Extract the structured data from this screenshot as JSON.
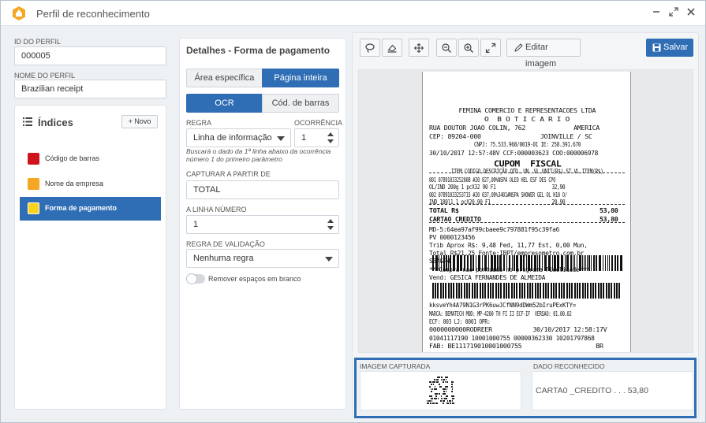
{
  "window": {
    "title": "Perfil de reconhecimento"
  },
  "profile": {
    "id_label": "ID DO PERFIL",
    "id_value": "000005",
    "name_label": "NOME DO PERFIL",
    "name_value": "Brazilian receipt"
  },
  "indices": {
    "title": "Índices",
    "new_label": "Novo",
    "items": [
      {
        "label": "Código de barras",
        "color": "#d0141b"
      },
      {
        "label": "Nome da empresa",
        "color": "#f5a623"
      },
      {
        "label": "Forma de pagamento",
        "color": "#f8d21c",
        "selected": true
      }
    ]
  },
  "details": {
    "title": "Detalhes - Forma de pagamento",
    "area_tabs": [
      "Área específica",
      "Página inteira"
    ],
    "area_selected": "Página inteira",
    "mode_tabs": [
      "OCR",
      "Cód. de barras"
    ],
    "mode_selected": "OCR",
    "rule_label": "REGRA",
    "rule_value": "Linha de informação",
    "occurrence_label": "OCORRÊNCIA",
    "occurrence_value": "1",
    "hint": "Buscará o dado da 1ª linha abaixo da ocorrência número 1 do primeiro parâmetro",
    "capture_label": "CAPTURAR A PARTIR DE",
    "capture_value": "TOTAL",
    "line_label": "A LINHA NÚMERO",
    "line_value": "1",
    "validation_label": "REGRA DE VALIDAÇÃO",
    "validation_value": "Nenhuma regra",
    "remove_spaces_label": "Remover espaços em branco",
    "remove_spaces_on": false
  },
  "toolbar": {
    "edit_label": "Editar imagem",
    "save_label": "Salvar"
  },
  "receipt": {
    "lines": [
      "FEMINA COMERCIO E REPRESENTACOES LTDA",
      "O  B O T I C A R I O",
      "RUA DOUTOR JOAO COLIN, 762             AMERICA",
      "CEP: 89204-000                JOINVILLE / SC",
      "CNPJ: 75.533.968/0019-01 IE: 258.391.670",
      "30/10/2017 12:57:48V CCF:000003623 COO:000006978",
      "CUPOM  FISCAL",
      "ITEM CODIGO DESCRIÇÃO QTD. UN. VL UNIT(R$) ST VL ITEM(R$)",
      "001 07891033252008 #20 027,09%NSPA OLEO HEL ESF DES CPO",
      "OL/IND 200g 1 pcX32 90 F1                     32,90",
      "002 07891033253715 #20 037,09%3401#NSPA SHOWER GEL OL H10 O/",
      "IND 180l1 1 pcX20,90 F1                       20,90",
      "TOTAL R$                                      53,80",
      "CARTAO CREDITO                                53,80",
      "MD-5:64ea97af99cbaee9c797881f95c39fa6",
      "PV 0000123456",
      "Trib Aprox R$: 9,48 Fed, 11,77 Est, 0,00 Mun,",
      "Total R$21,25 Fonte:IBPT/empresometro.com.br",
      "S3AGR4",
      "***Compra nao pontuada no programa Fidelidade***",
      "Vend: GESICA FERNANDES DE ALMEIDA",
      "kksveYh4A79N1G3rPK6uwJCfNN9dDWm52bIruPExKTY=",
      "MARCA: BEMATECH MOD: MP-4200 TH FI II ECF-IF  VERSAO: 01.00.02",
      "ECF: 003 LJ: 0001 OPR:",
      "0000000000RODREER           30/10/2017 12:58:17V",
      "01041117190 10001000755 00000362330 10201797868",
      "FAB: BE111719010001000755                    BR"
    ]
  },
  "captured": {
    "image_label": "IMAGEM CAPTURADA",
    "data_label": "DADO RECONHECIDO",
    "data_value": "CARTA0 _CREDITO . . . 53,80"
  }
}
